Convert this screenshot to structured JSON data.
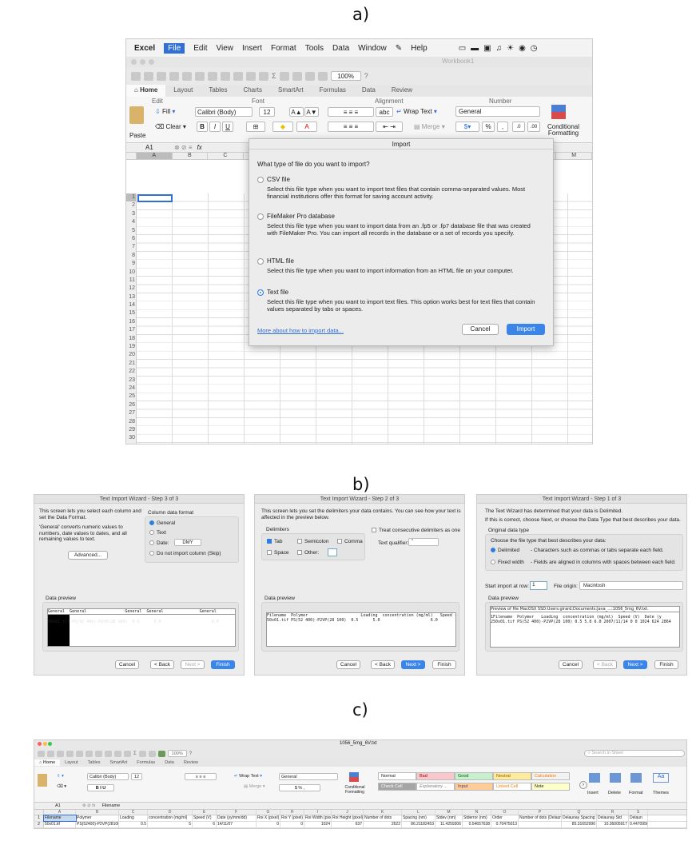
{
  "labels": {
    "a": "a)",
    "b": "b)",
    "c": "c)"
  },
  "excel_a": {
    "menu": [
      "Excel",
      "File",
      "Edit",
      "View",
      "Insert",
      "Format",
      "Tools",
      "Data",
      "Window",
      "Help"
    ],
    "window_title": "Workbook1",
    "zoom": "100%",
    "tabs": [
      "Home",
      "Layout",
      "Tables",
      "Charts",
      "SmartArt",
      "Formulas",
      "Data",
      "Review"
    ],
    "ribbon": {
      "edit_group": "Edit",
      "font_group": "Font",
      "alignment_group": "Alignment",
      "number_group": "Number",
      "fill": "Fill",
      "clear": "Clear",
      "paste": "Paste",
      "font_name": "Calibri (Body)",
      "font_size": "12",
      "wrap_text": "Wrap Text",
      "merge": "Merge",
      "number_format": "General",
      "conditional_formatting": "Conditional Formatting"
    },
    "name_box": "A1",
    "fx": "fx",
    "columns": [
      "A",
      "B",
      "C",
      "M"
    ],
    "row_count": 35
  },
  "import_dialog": {
    "title": "Import",
    "question": "What type of file do you want to import?",
    "options": [
      {
        "label": "CSV file",
        "desc": "Select this file type when you want to import text files that contain comma-separated values. Most financial institutions offer this format for saving account activity.",
        "selected": false
      },
      {
        "label": "FileMaker Pro database",
        "desc": "Select this file type when you want to import data from an .fp5 or .fp7 database file that was created with FileMaker Pro.  You can import all records in the database or a set of records you specify.",
        "selected": false
      },
      {
        "label": "HTML file",
        "desc": "Select this file type when you want to import information from an HTML file on your computer.",
        "selected": false
      },
      {
        "label": "Text file",
        "desc": "Select this file type when you want to import text files.  This option works best for text files that contain values separated by tabs or spaces.",
        "selected": true
      }
    ],
    "more_link": "More about how to import data...",
    "cancel": "Cancel",
    "import": "Import"
  },
  "wizard3": {
    "title": "Text Import Wizard - Step 3 of 3",
    "intro": "This screen lets you select each column and set the Data Format.",
    "note": "'General' converts numeric values to numbers, date values to dates, and all remaining values to text.",
    "advanced": "Advanced...",
    "column_format_label": "Column data format",
    "formats": [
      "General",
      "Text",
      "Date:",
      "Do not import column (Skip)"
    ],
    "date_value": "DMY",
    "preview_label": "Data preview",
    "preview_headers": [
      "General",
      "General",
      "General",
      "General",
      "General"
    ],
    "preview_lines": [
      "Filename  Polymer                      Loading  concentration (mg/ml)   Speed",
      "50x01.tif PS(52 400)-P2VP(28 100)  0.5      5.0                     6.0"
    ],
    "buttons": {
      "cancel": "Cancel",
      "back": "< Back",
      "next": "Next >",
      "finish": "Finish"
    }
  },
  "wizard2": {
    "title": "Text Import Wizard - Step 2 of 3",
    "intro": "This screen lets you set the delimiters your data contains.  You can see how your text is affected in the preview below.",
    "delimiters_label": "Delimiters",
    "delims": [
      "Tab",
      "Semicolon",
      "Comma",
      "Space",
      "Other:"
    ],
    "consecutive": "Treat consecutive delimiters as one",
    "qualifier_label": "Text qualifier:",
    "qualifier_value": "\"",
    "preview_label": "Data preview",
    "preview_lines": [
      "Filename  Polymer                      Loading  concentration (mg/ml)   Speed (",
      "50x01.tif PS(52 400)-P2VP(28 100)  0.5      5.0                     6.0"
    ],
    "buttons": {
      "cancel": "Cancel",
      "back": "< Back",
      "next": "Next >",
      "finish": "Finish"
    }
  },
  "wizard1": {
    "title": "Text Import Wizard - Step 1 of 3",
    "intro": "The Text Wizard has determined that your data is Delimited.",
    "intro2": "If this is correct, choose Next, or choose the Data Type that best describes your data.",
    "original_label": "Original data type",
    "choose_label": "Choose the file type that best describes your data:",
    "types": [
      {
        "name": "Delimited",
        "desc": "- Characters such as commas or tabs separate each field."
      },
      {
        "name": "Fixed width",
        "desc": "- Fields are aligned in columns with spaces between each field."
      }
    ],
    "start_row_label": "Start import at row:",
    "start_row": "1",
    "origin_label": "File origin:",
    "origin_value": "Macintosh",
    "preview_label": "Data preview",
    "preview_file": "Preview of file MacOSX SSD:Users:girard:Documents:Java_...:1056_5mg_6V.txt.",
    "preview_lines": [
      "1Filename  Polymer   Loading  concentration (mg/ml)  Speed (V)  Date (y",
      "250x01.tif PS(52 400)-P2VP(28 100) 0.5 5.0 6.0 2007/11/14 0 0 1024 624 2864"
    ],
    "buttons": {
      "cancel": "Cancel",
      "back": "< Back",
      "next": "Next >",
      "finish": "Finish"
    }
  },
  "excel_c": {
    "window_title": "1056_5mg_6V.txt",
    "search_placeholder": "Search in Sheet",
    "zoom": "100%",
    "tabs": [
      "Home",
      "Layout",
      "Tables",
      "SmartArt",
      "Formulas",
      "Data",
      "Review"
    ],
    "font_name": "Calibri (Body)",
    "font_size": "12",
    "number_format": "General",
    "wrap_text": "Wrap Text",
    "merge": "Merge",
    "conditional_formatting": "Conditional Formatting",
    "styles": [
      {
        "name": "Normal",
        "bg": "#ffffff",
        "fg": "#222222"
      },
      {
        "name": "Bad",
        "bg": "#f8c8cc",
        "fg": "#9c0006"
      },
      {
        "name": "Good",
        "bg": "#c8efce",
        "fg": "#006100"
      },
      {
        "name": "Neutral",
        "bg": "#ffeb9c",
        "fg": "#9c5700"
      },
      {
        "name": "Calculation",
        "bg": "#f2f2f2",
        "fg": "#fa7d00"
      },
      {
        "name": "Check Cell",
        "bg": "#a5a5a5",
        "fg": "#ffffff"
      },
      {
        "name": "Explanatory ...",
        "bg": "#ffffff",
        "fg": "#7f7f7f"
      },
      {
        "name": "Input",
        "bg": "#ffcc99",
        "fg": "#3f3f76"
      },
      {
        "name": "Linked Cell",
        "bg": "#ffffff",
        "fg": "#fa7d00"
      },
      {
        "name": "Note",
        "bg": "#ffffcc",
        "fg": "#222222"
      }
    ],
    "cells_buttons": [
      "Insert",
      "Delete",
      "Format"
    ],
    "themes": [
      "Themes",
      "Aa"
    ],
    "name_box": "A1",
    "formula": "Filename",
    "columns": [
      "A",
      "B",
      "C",
      "D",
      "E",
      "F",
      "G",
      "H",
      "I",
      "J",
      "K",
      "L",
      "M",
      "N",
      "O",
      "P",
      "Q",
      "R",
      "S"
    ],
    "row1": [
      "Filename",
      "Polymer",
      "Loading",
      "concentration (mg/ml)",
      "Speed (V)",
      "Date (yy/mm/dd)",
      "Roi X (pixel)",
      "Roi Y (pixel)",
      "Roi Width (pixel)",
      "Roi Height (pixel)",
      "Number of dots",
      "Spacing (nm)",
      "Stdev (nm)",
      "Stderror (nm)",
      "Order",
      "Number of dots (Delaunay)",
      "Delaunay Spacing (nm)",
      "Delaunay Std",
      "Delaun"
    ],
    "row2": [
      "50x01.tif",
      "PS(52400)-P2VP(28100)",
      "0.5",
      "5",
      "6",
      "14/11/07",
      "0",
      "0",
      "1024",
      "637",
      "2622",
      "86.21182453",
      "11.4259306",
      "0.54657638",
      "0.70475013",
      "",
      "85.31652996",
      "10.36005917",
      "0.44709568",
      "0.7076"
    ]
  }
}
